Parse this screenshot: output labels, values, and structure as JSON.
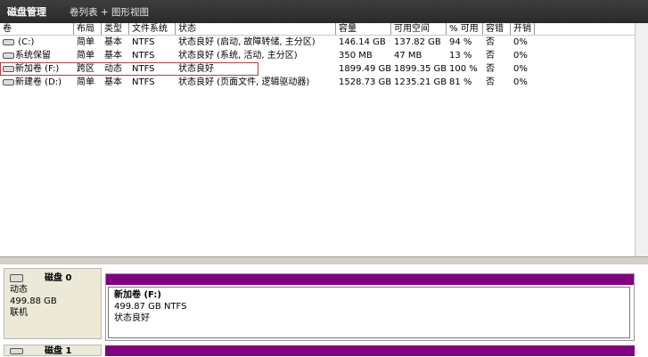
{
  "titlebar": {
    "app": "磁盘管理",
    "view": "卷列表 + 图形视图"
  },
  "columns": [
    "卷",
    "布局",
    "类型",
    "文件系统",
    "状态",
    "容量",
    "可用空间",
    "% 可用",
    "容错",
    "开销"
  ],
  "volumes": [
    {
      "name": "(C:)",
      "layout": "简单",
      "type": "基本",
      "fs": "NTFS",
      "status": "状态良好 (启动, 故障转储, 主分区)",
      "capacity": "146.14 GB",
      "free": "137.82 GB",
      "pct": "94 %",
      "fault": "否",
      "overhead": "0%"
    },
    {
      "name": "系统保留",
      "layout": "简单",
      "type": "基本",
      "fs": "NTFS",
      "status": "状态良好 (系统, 活动, 主分区)",
      "capacity": "350 MB",
      "free": "47 MB",
      "pct": "13 %",
      "fault": "否",
      "overhead": "0%"
    },
    {
      "name": "新加卷 (F:)",
      "layout": "跨区",
      "type": "动态",
      "fs": "NTFS",
      "status": "状态良好",
      "capacity": "1899.49 GB",
      "free": "1899.35 GB",
      "pct": "100 %",
      "fault": "否",
      "overhead": "0%"
    },
    {
      "name": "新建卷 (D:)",
      "layout": "简单",
      "type": "基本",
      "fs": "NTFS",
      "status": "状态良好 (页面文件, 逻辑驱动器)",
      "capacity": "1528.73 GB",
      "free": "1235.21 GB",
      "pct": "81 %",
      "fault": "否",
      "overhead": "0%"
    }
  ],
  "disk0": {
    "name": "磁盘 0",
    "type": "动态",
    "size": "499.88 GB",
    "state": "联机",
    "volume": {
      "name": "新加卷 (F:)",
      "size": "499.87 GB NTFS",
      "status": "状态良好"
    }
  },
  "disk1": {
    "name": "磁盘 1"
  },
  "colors": {
    "volume_bar": "#800080",
    "titlebar": "#333333"
  }
}
